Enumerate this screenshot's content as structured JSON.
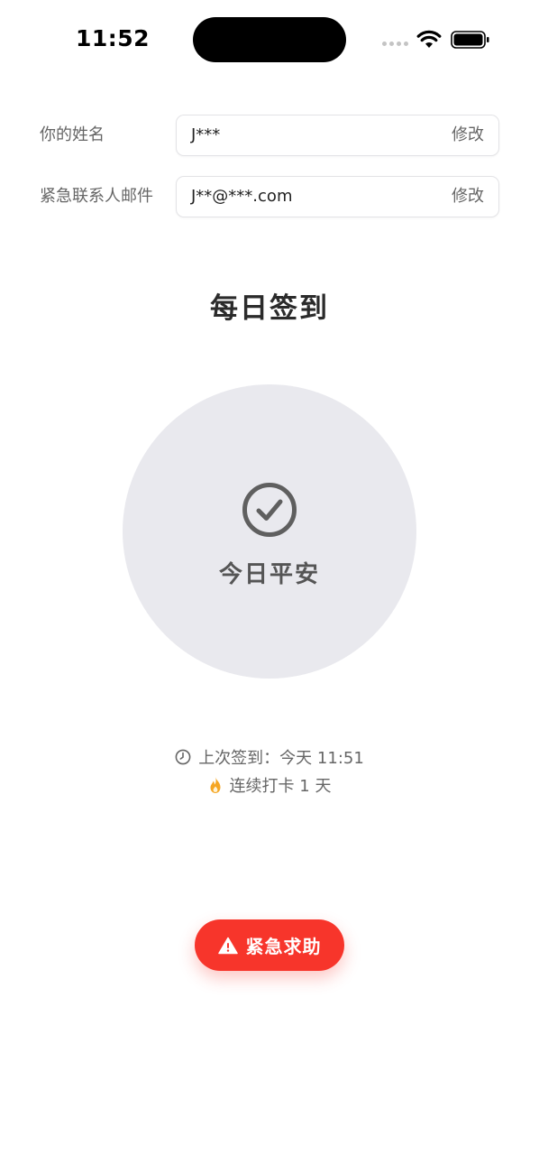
{
  "status_bar": {
    "time": "11:52"
  },
  "profile": {
    "name": {
      "label": "你的姓名",
      "value": "J***",
      "edit_label": "修改"
    },
    "emergency_contact": {
      "label": "紧急联系人邮件",
      "value": "J**@***.com",
      "edit_label": "修改"
    }
  },
  "checkin": {
    "title": "每日签到",
    "button_label": "今日平安",
    "last_checkin": "上次签到：今天 11:51",
    "streak": "连续打卡 1 天"
  },
  "sos": {
    "label": "紧急求助"
  },
  "icons": {
    "check": "check-circle-icon",
    "clock": "clock-icon",
    "streak": "flame-icon",
    "sos": "warning-triangle-icon"
  },
  "colors": {
    "accent_red": "#f7352b",
    "circle_bg": "#e9e9ee",
    "flame": "#f5a623"
  }
}
